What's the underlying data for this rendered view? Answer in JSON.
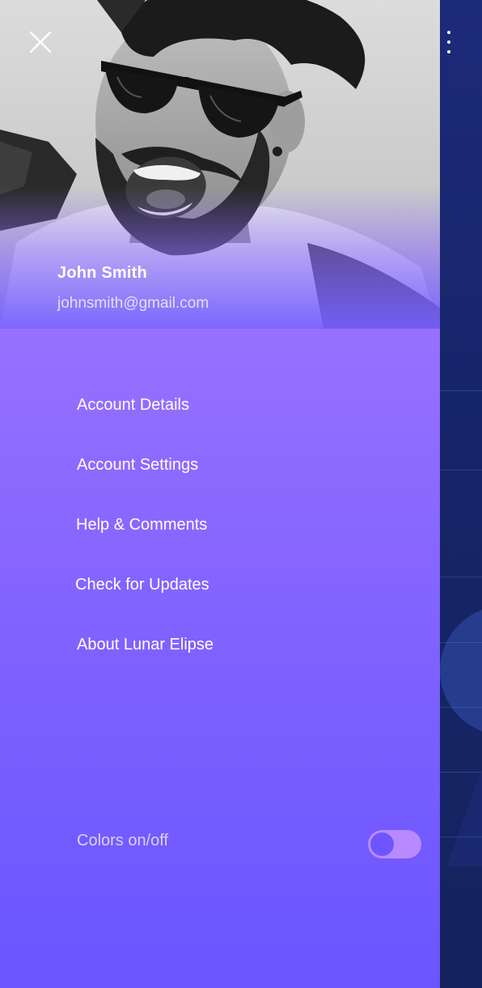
{
  "profile": {
    "name": "John Smith",
    "email": "johnsmith@gmail.com"
  },
  "menu": {
    "items": [
      {
        "label": "Account Details"
      },
      {
        "label": "Account Settings"
      },
      {
        "label": "Help & Comments"
      },
      {
        "label": "Check for Updates"
      },
      {
        "label": "About Lunar Elipse"
      }
    ]
  },
  "settings": {
    "colors_toggle_label": "Colors on/off",
    "colors_toggle_on": false
  },
  "icons": {
    "close": "close-icon",
    "more": "more-vertical-icon",
    "avatar": "profile-photo"
  },
  "colors": {
    "drawer_top": "#a87bff",
    "drawer_bottom": "#6a55ff",
    "background_app": "#1a2466",
    "toggle_track": "#b98aff",
    "toggle_knob": "#6c55ff"
  }
}
